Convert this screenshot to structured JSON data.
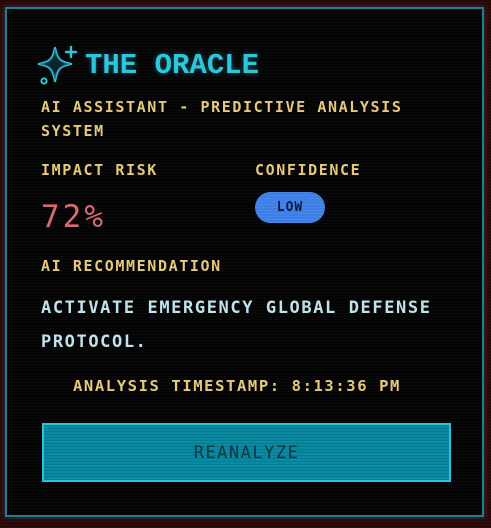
{
  "header": {
    "title": "THE ORACLE",
    "logo_icon": "sparkles-icon",
    "subtitle": "AI ASSISTANT - PREDICTIVE ANALYSIS SYSTEM"
  },
  "metrics": {
    "impact_risk_label": "IMPACT RISK",
    "impact_risk_value": "72%",
    "confidence_label": "CONFIDENCE",
    "confidence_value": "LOW"
  },
  "recommendation": {
    "label": "AI RECOMMENDATION",
    "text": "ACTIVATE EMERGENCY GLOBAL DEFENSE PROTOCOL."
  },
  "timestamp": "ANALYSIS TIMESTAMP: 8:13:36 PM",
  "actions": {
    "reanalyze_label": "REANALYZE"
  },
  "colors": {
    "accent": "#2ec6dc",
    "label": "#e6c97a",
    "risk": "#d96a72",
    "badge": "#3b7fe6",
    "button": "#0a8aa3",
    "panel_border": "#1d7f92"
  }
}
